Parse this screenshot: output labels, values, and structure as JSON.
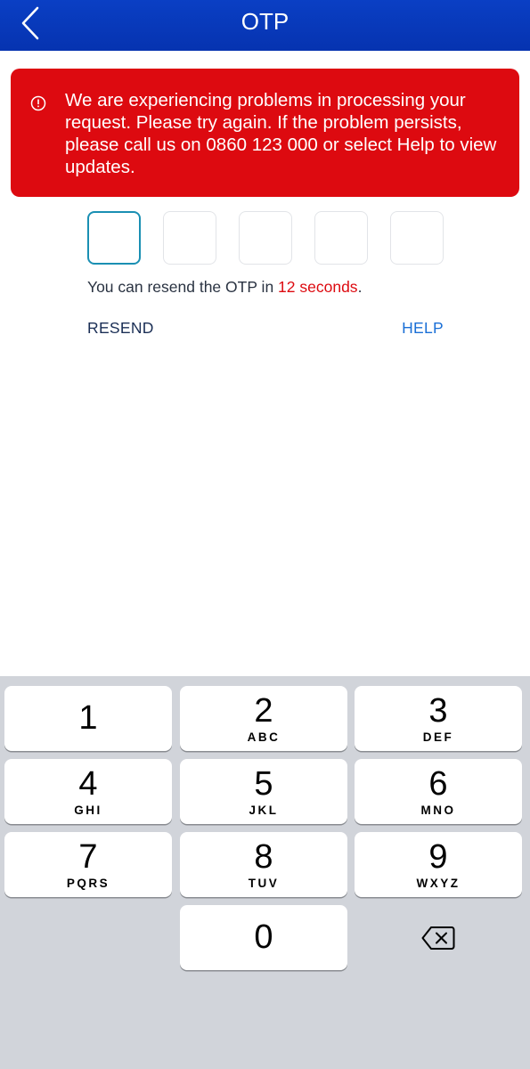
{
  "header": {
    "title": "OTP",
    "back_icon": "chevron-left-icon"
  },
  "alert": {
    "icon": "exclamation-circle-icon",
    "message": "We are experiencing problems in processing your request. Please try again. If the problem persists, please call us on 0860 123 000 or select Help to view updates.",
    "color": "#dd0a10"
  },
  "otp": {
    "digit_count": 5,
    "values": [
      "",
      "",
      "",
      "",
      ""
    ],
    "active_index": 0
  },
  "resend": {
    "prefix": "You can resend the OTP in",
    "countdown": "12 seconds",
    "suffix": ".",
    "resend_label": "RESEND",
    "help_label": "HELP"
  },
  "keyboard": {
    "keys": [
      {
        "digit": "1",
        "letters": ""
      },
      {
        "digit": "2",
        "letters": "ABC"
      },
      {
        "digit": "3",
        "letters": "DEF"
      },
      {
        "digit": "4",
        "letters": "GHI"
      },
      {
        "digit": "5",
        "letters": "JKL"
      },
      {
        "digit": "6",
        "letters": "MNO"
      },
      {
        "digit": "7",
        "letters": "PQRS"
      },
      {
        "digit": "8",
        "letters": "TUV"
      },
      {
        "digit": "9",
        "letters": "WXYZ"
      },
      {
        "digit": "0",
        "letters": ""
      }
    ],
    "delete_icon": "backspace-icon"
  },
  "colors": {
    "header_blue": "#0633b0",
    "error_red": "#dd0a10",
    "link_blue": "#1a6fd6",
    "active_border": "#1a8fb3"
  }
}
